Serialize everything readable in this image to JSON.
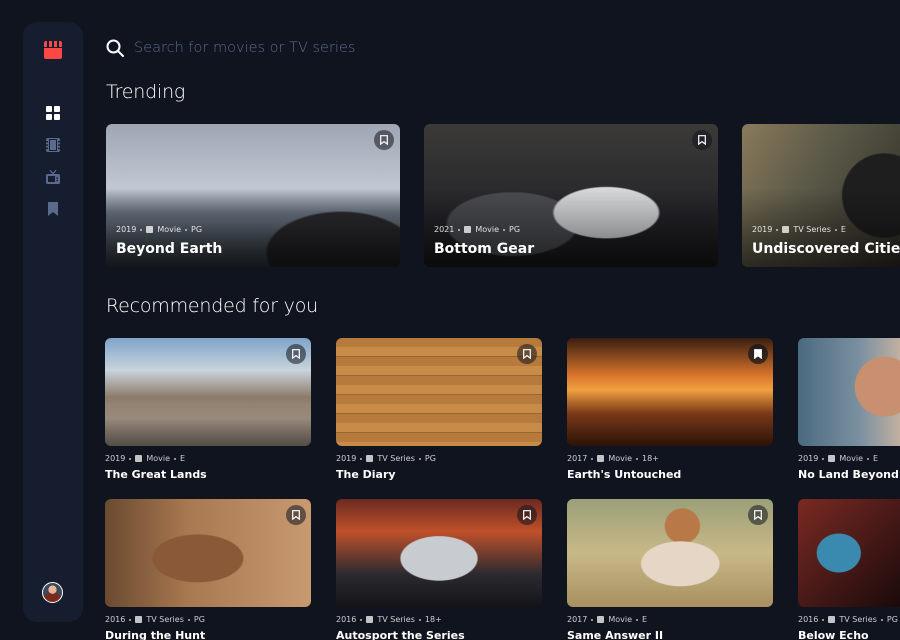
{
  "search": {
    "placeholder": "Search for movies or TV series"
  },
  "sections": {
    "trending": "Trending",
    "recommended": "Recommended for you"
  },
  "nav": {
    "logo_icon": "movie-clapper-icon",
    "items": [
      {
        "icon": "home-grid-icon",
        "active": true
      },
      {
        "icon": "film-icon",
        "active": false
      },
      {
        "icon": "tv-icon",
        "active": false
      },
      {
        "icon": "bookmark-icon",
        "active": false
      }
    ]
  },
  "colors": {
    "background": "#10141e",
    "sidebar": "#161d2f",
    "accent": "#fc4747",
    "muted": "#5a6a8c"
  },
  "trending": [
    {
      "year": "2019",
      "category": "Movie",
      "rating": "PG",
      "title": "Beyond Earth",
      "bookmarked": false
    },
    {
      "year": "2021",
      "category": "Movie",
      "rating": "PG",
      "title": "Bottom Gear",
      "bookmarked": false
    },
    {
      "year": "2019",
      "category": "TV Series",
      "rating": "E",
      "title": "Undiscovered Cities",
      "bookmarked": false
    }
  ],
  "recommended": [
    {
      "year": "2019",
      "category": "Movie",
      "rating": "E",
      "title": "The Great Lands",
      "bookmarked": false
    },
    {
      "year": "2019",
      "category": "TV Series",
      "rating": "PG",
      "title": "The Diary",
      "bookmarked": false
    },
    {
      "year": "2017",
      "category": "Movie",
      "rating": "18+",
      "title": "Earth's Untouched",
      "bookmarked": true
    },
    {
      "year": "2019",
      "category": "Movie",
      "rating": "E",
      "title": "No Land Beyond",
      "bookmarked": false
    },
    {
      "year": "2016",
      "category": "TV Series",
      "rating": "PG",
      "title": "During the Hunt",
      "bookmarked": false
    },
    {
      "year": "2016",
      "category": "TV Series",
      "rating": "18+",
      "title": "Autosport the Series",
      "bookmarked": false
    },
    {
      "year": "2017",
      "category": "Movie",
      "rating": "E",
      "title": "Same Answer II",
      "bookmarked": false
    },
    {
      "year": "2016",
      "category": "TV Series",
      "rating": "PG",
      "title": "Below Echo",
      "bookmarked": false
    }
  ]
}
